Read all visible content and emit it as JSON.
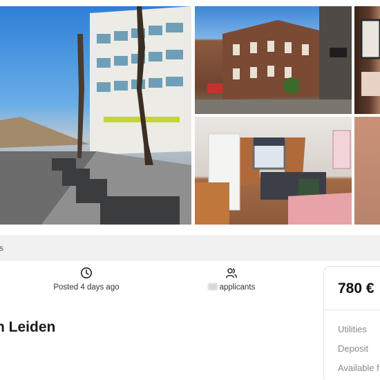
{
  "gallery": {
    "photos": [
      {
        "name": "street-photo"
      },
      {
        "name": "building-photo"
      },
      {
        "name": "edge-photo-1"
      },
      {
        "name": "bedroom-photo"
      },
      {
        "name": "edge-photo-2"
      }
    ],
    "colors": {
      "sky": "#2f7fd8",
      "brick": "#6e4430",
      "floor": "#8c5a3a"
    }
  },
  "tab_bar": {
    "mark": "s"
  },
  "meta": {
    "posted": {
      "icon": "clock-icon",
      "text": "Posted 4 days ago"
    },
    "applicants": {
      "icon": "users-icon",
      "text": "applicants"
    }
  },
  "listing": {
    "title": "n Leiden"
  },
  "price_card": {
    "price": "780 €",
    "rows": [
      "Utilities",
      "Deposit",
      "Available f"
    ]
  }
}
